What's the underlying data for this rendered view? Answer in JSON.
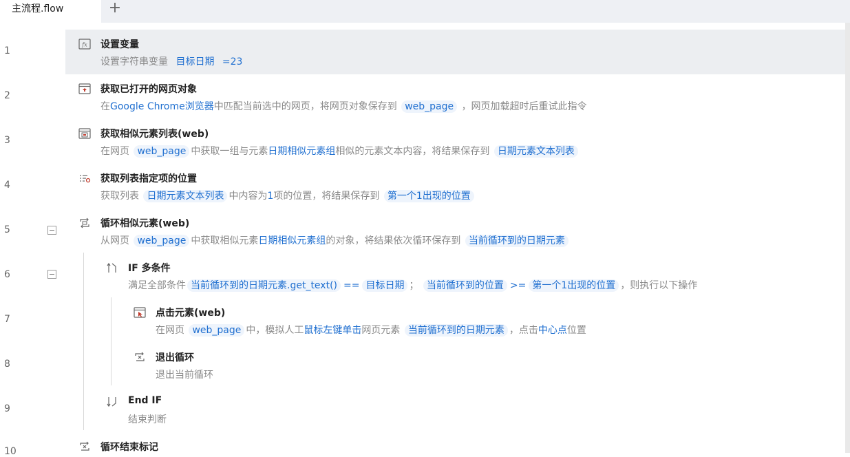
{
  "tabs": {
    "active_label": "主流程.flow",
    "add_label": "+"
  },
  "line_numbers": [
    "1",
    "2",
    "3",
    "4",
    "5",
    "6",
    "7",
    "8",
    "9",
    "10"
  ],
  "steps": {
    "s1": {
      "title": "设置变量",
      "d1": "设置字符串变量",
      "v1": "目标日期",
      "d2": "=23"
    },
    "s2": {
      "title": "获取已打开的网页对象",
      "d1": "在",
      "h1": "Google Chrome浏览器",
      "d2": "中匹配当前选中的网页，将网页对象保存到",
      "v1": "web_page",
      "d3": "，网页加载超时后重试此指令"
    },
    "s3": {
      "title": "获取相似元素列表(web)",
      "d1": "在网页",
      "v1": "web_page",
      "d2": "中获取一组与元素",
      "h1": "日期相似元素组",
      "d3": "相似的元素文本内容，将结果保存到",
      "v2": "日期元素文本列表"
    },
    "s4": {
      "title": "获取列表指定项的位置",
      "d1": "获取列表",
      "v1": "日期元素文本列表",
      "d2": "中内容为",
      "h1": "1",
      "d3": "项的位置，将结果保存到",
      "v2": "第一个1出现的位置"
    },
    "s5": {
      "title": "循环相似元素(web)",
      "d1": "从网页",
      "v1": "web_page",
      "d2": "中获取相似元素",
      "h1": "日期相似元素组",
      "d3": "的对象，将结果依次循环保存到",
      "v2": "当前循环到的日期元素"
    },
    "s6": {
      "title": "IF 多条件",
      "d1": "满足全部条件",
      "v1": "当前循环到的日期元素.get_text()",
      "op1": "==",
      "v2": "目标日期",
      "d2": "；",
      "v3": "当前循环到的位置",
      "op2": ">=",
      "v4": "第一个1出现的位置",
      "d3": "，则执行以下操作"
    },
    "s7": {
      "title": "点击元素(web)",
      "d1": "在网页",
      "v1": "web_page",
      "d2": "中，模拟人工",
      "h1": "鼠标左键单击",
      "d3": "网页元素",
      "v2": "当前循环到的日期元素",
      "d4": "，点击",
      "h2": "中心点",
      "d5": "位置"
    },
    "s8": {
      "title": "退出循环",
      "d1": "退出当前循环"
    },
    "s9": {
      "title": "End IF",
      "d1": "结束判断"
    },
    "s10": {
      "title": "循环结束标记"
    }
  },
  "icons": {
    "s1": "function-icon",
    "s2": "browser-window-icon",
    "s3": "element-list-icon",
    "s4": "list-position-icon",
    "s5": "loop-icon",
    "s6": "if-branch-icon",
    "s7": "click-element-icon",
    "s8": "exit-loop-icon",
    "s9": "end-if-icon",
    "s10": "loop-end-icon"
  },
  "colors": {
    "variable_bg": "#eef4fc",
    "variable_text": "#1f6fd0",
    "selected_row": "#eceef1",
    "tab_bar": "#eef0f4"
  }
}
